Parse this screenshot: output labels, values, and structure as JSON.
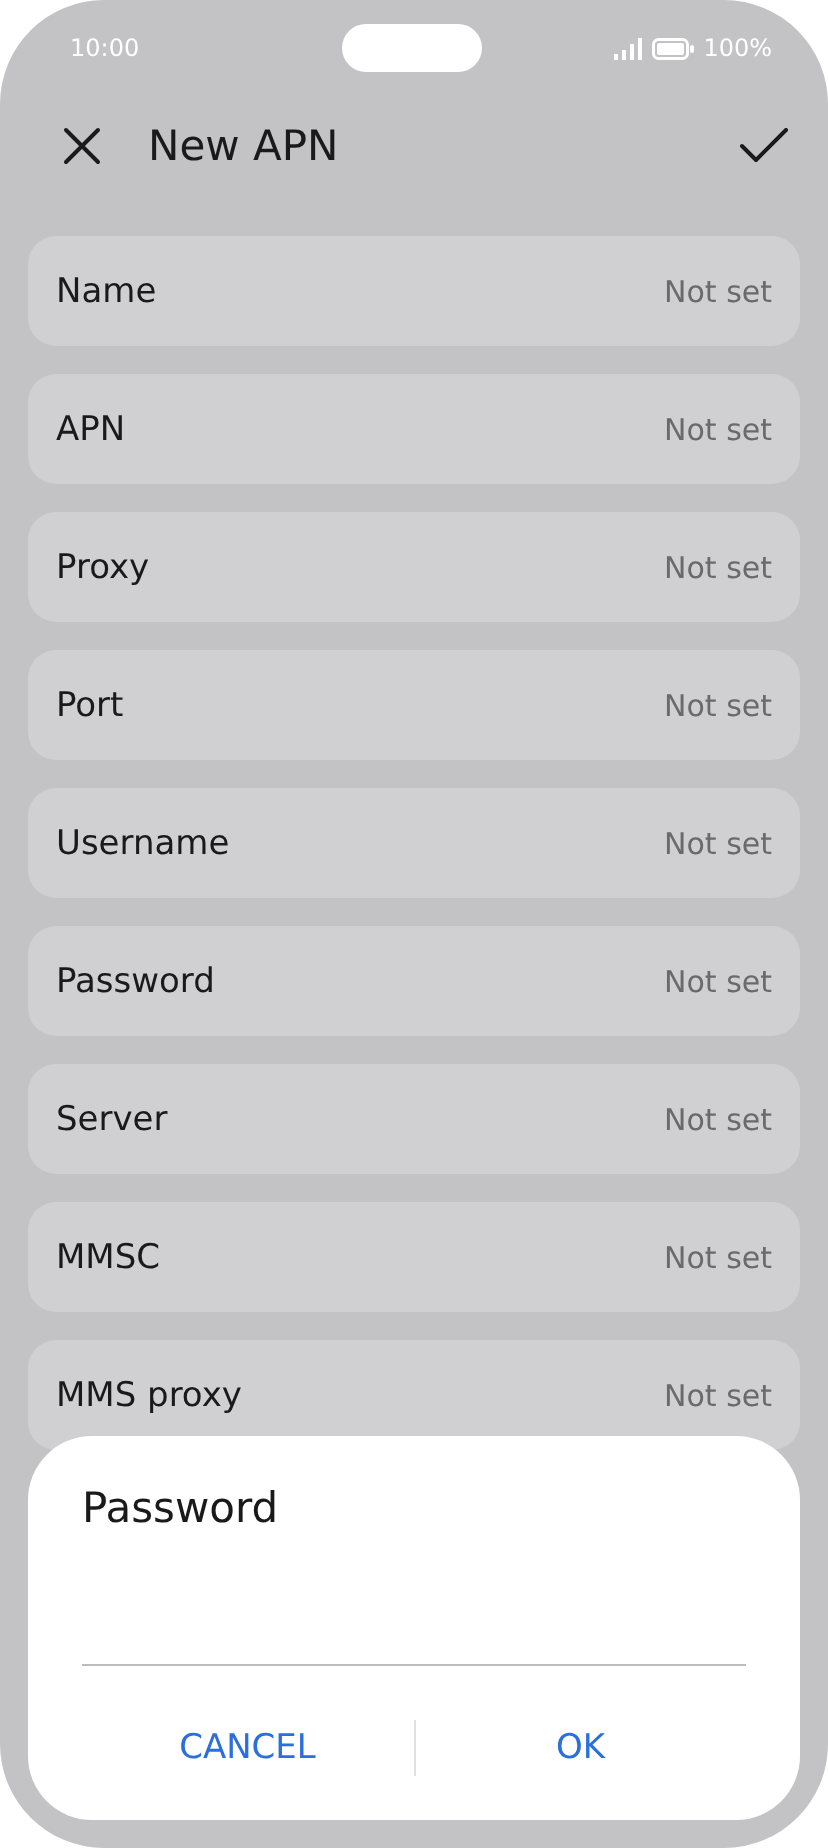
{
  "status_bar": {
    "time": "10:00",
    "battery": "100%"
  },
  "title": "New APN",
  "fields": [
    {
      "label": "Name",
      "value": "Not set"
    },
    {
      "label": "APN",
      "value": "Not set"
    },
    {
      "label": "Proxy",
      "value": "Not set"
    },
    {
      "label": "Port",
      "value": "Not set"
    },
    {
      "label": "Username",
      "value": "Not set"
    },
    {
      "label": "Password",
      "value": "Not set"
    },
    {
      "label": "Server",
      "value": "Not set"
    },
    {
      "label": "MMSC",
      "value": "Not set"
    },
    {
      "label": "MMS proxy",
      "value": "Not set"
    }
  ],
  "dialog": {
    "title": "Password",
    "buttons": [
      "CANCEL",
      "OK"
    ]
  }
}
